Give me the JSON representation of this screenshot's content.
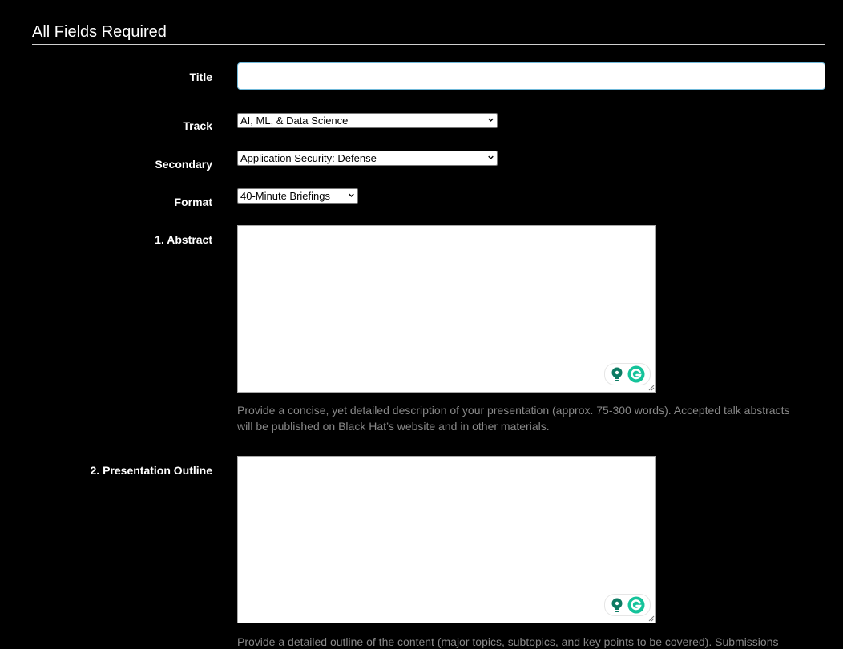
{
  "section": {
    "title": "All Fields Required"
  },
  "fields": {
    "title": {
      "label": "Title",
      "value": ""
    },
    "track": {
      "label": "Track",
      "selected": "AI, ML, & Data Science"
    },
    "secondary": {
      "label": "Secondary",
      "selected": "Application Security: Defense"
    },
    "format": {
      "label": "Format",
      "selected": "40-Minute Briefings"
    },
    "abstract": {
      "label": "1. Abstract",
      "value": "",
      "help_line1": "Provide a concise, yet detailed description of your presentation (approx. 75-300 words). Accepted talk abstracts",
      "help_line2": "will be published on Black Hat’s website and in other materials."
    },
    "outline": {
      "label": "2. Presentation Outline",
      "value": "",
      "help_line1": "Provide a detailed outline of the content (major topics, subtopics, and key points to be covered). Submissions"
    }
  },
  "icons": {
    "lightbulb": "lightbulb-icon",
    "grammarly": "grammarly-icon",
    "chevron": "chevron-down-icon",
    "grip": "resize-grip-icon"
  },
  "colors": {
    "background": "#000000",
    "text": "#ffffff",
    "help_text": "#888888",
    "input_focus_border": "#6fb8d9",
    "grammarly_green": "#15c39a",
    "grammarly_dark": "#0d7b63"
  }
}
